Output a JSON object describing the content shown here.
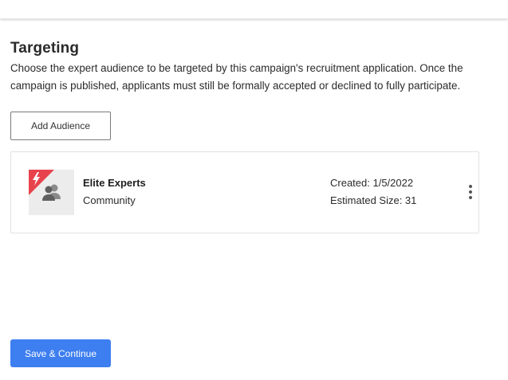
{
  "section": {
    "title": "Targeting",
    "description": "Choose the expert audience to be targeted by this campaign's recruitment application. Once the campaign is published, applicants must still be formally accepted or declined to fully participate."
  },
  "buttons": {
    "add_audience": "Add Audience",
    "save_continue": "Save & Continue"
  },
  "audiences": [
    {
      "name": "Elite Experts",
      "type": "Community",
      "created": "Created: 1/5/2022",
      "estimated_size": "Estimated Size: 31",
      "icon": "community-people-icon",
      "badge_icon": "lightning-bolt-icon",
      "badge_color": "#e8434c"
    }
  ],
  "colors": {
    "primary": "#3d7ef0",
    "badge": "#e8434c"
  }
}
